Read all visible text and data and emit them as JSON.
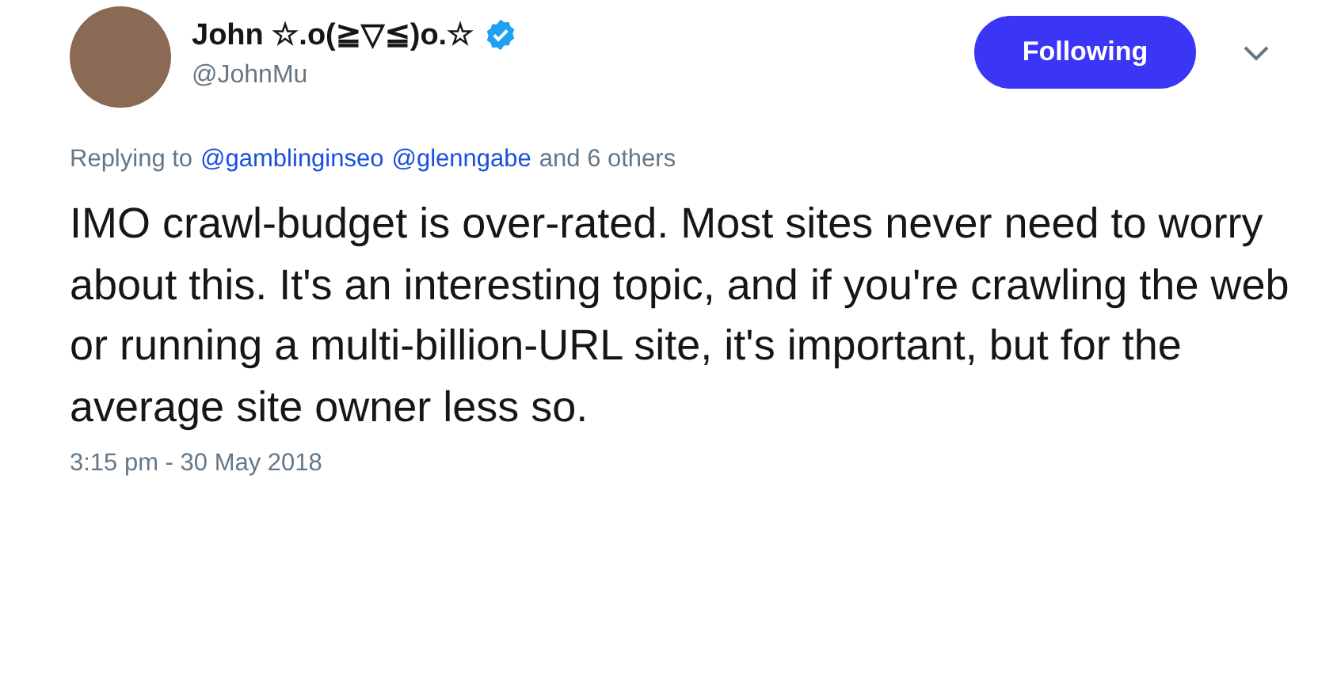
{
  "author": {
    "name": "John ☆.o(≧▽≦)o.☆",
    "verified": true,
    "handle": "@JohnMu"
  },
  "follow_button": {
    "label": "Following",
    "following": true
  },
  "reply_context": {
    "prefix": "Replying to",
    "mentions": [
      "@gamblinginseo",
      "@glenngabe"
    ],
    "suffix": "and 6 others"
  },
  "text": "IMO crawl-budget is over-rated. Most sites never need to worry about this. It's an interesting topic, and if you're crawling the web or running a multi-billion-URL site, it's important, but for the average site owner less so.",
  "timestamp": "3:15 pm - 30 May 2018"
}
